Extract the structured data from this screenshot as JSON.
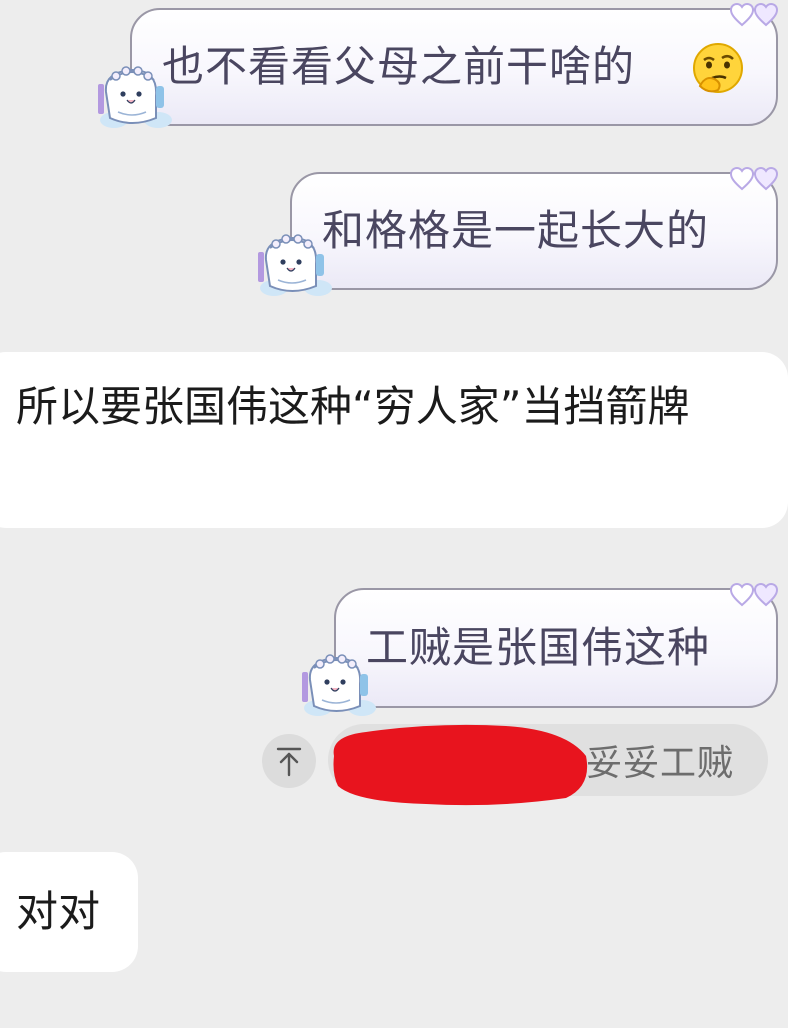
{
  "messages": [
    {
      "direction": "outgoing",
      "text": "也不看看父母之前干啥的",
      "emoji": "thinking-face"
    },
    {
      "direction": "outgoing",
      "text": "和格格是一起长大的"
    },
    {
      "direction": "incoming",
      "text": "所以要张国伟这种“穷人家”当挡箭牌"
    },
    {
      "direction": "outgoing",
      "text": "工贼是张国伟这种"
    },
    {
      "direction": "incoming",
      "text": "对对"
    }
  ],
  "quote": {
    "text": "妥妥工贼",
    "icon": "quote-arrow-icon",
    "redacted": true,
    "redaction_color": "#e8141e"
  },
  "decorations": {
    "bubble_sticker": "mascot-sticker",
    "bubble_corner": "hearts-icon",
    "heart_color": "#b9a9e6"
  },
  "colors": {
    "background": "#ededed",
    "outgoing_text": "#4a4660",
    "incoming_text": "#1b1b1b",
    "outgoing_border": "#9a97a6"
  }
}
